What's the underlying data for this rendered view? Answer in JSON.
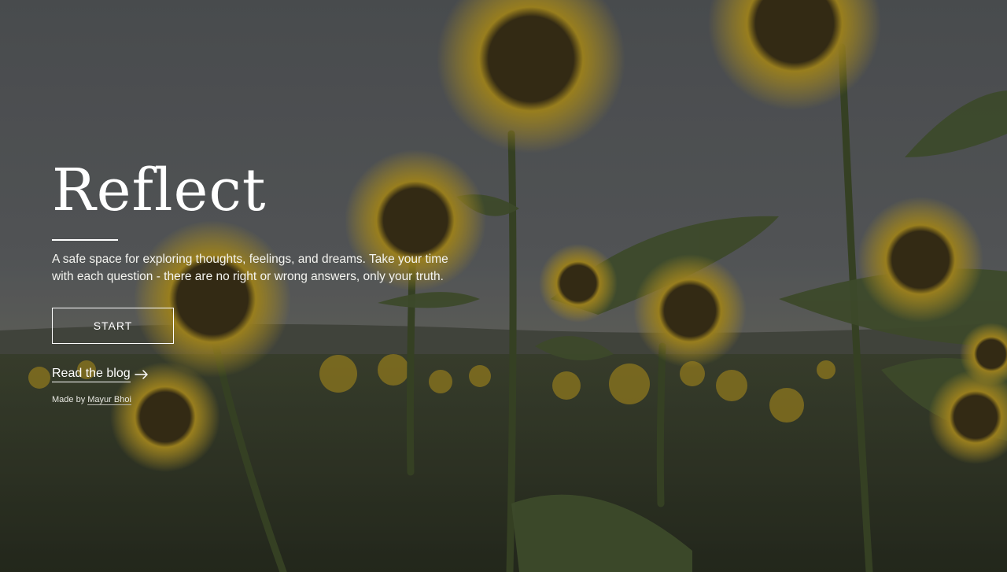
{
  "hero": {
    "title": "Reflect",
    "tagline": "A safe space for exploring thoughts, feelings, and dreams. Take your time with each question - there are no right or wrong answers, only your truth.",
    "start_label": "START",
    "blog_label": "Read the blog",
    "arrow_icon": "arrow-right-icon"
  },
  "credit": {
    "prefix": "Made by ",
    "name": "Mayur Bhoi"
  },
  "background": {
    "description_icon": "sunflower-field-photo",
    "sky_color": "#5c5f5e",
    "petal_color": "#c9a626",
    "leaf_color": "#3d4a2c"
  }
}
